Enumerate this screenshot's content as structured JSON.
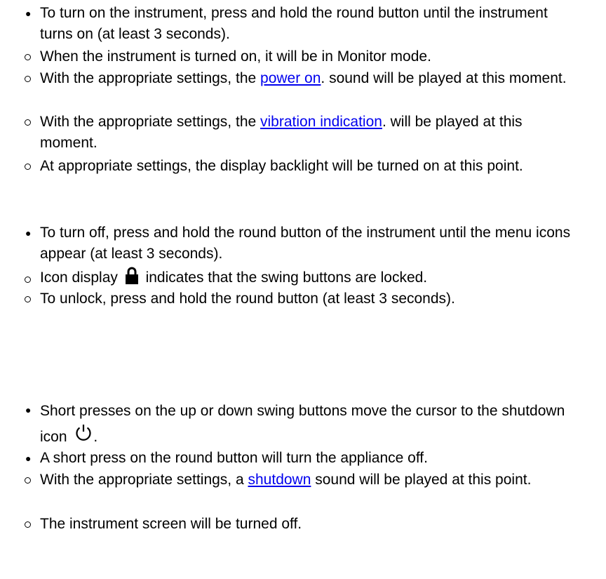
{
  "items": [
    {
      "marker": "disc",
      "text": "To turn on the instrument, press and hold the round button until the instrument turns on (at least 3 seconds)."
    },
    {
      "marker": "circle",
      "text": "When the instrument is turned on, it will be in Monitor mode."
    },
    {
      "marker": "circle",
      "pre": "With the appropriate settings, the ",
      "link": "power on",
      "post": ". sound will be played at this moment."
    },
    {
      "marker": "circle",
      "pre": "With the appropriate settings, the ",
      "link": "vibration indication",
      "post": ". will be played at this moment."
    },
    {
      "marker": "circle",
      "text": "At appropriate settings, the display backlight will be turned on at this point."
    },
    {
      "marker": "disc",
      "text": "To turn off, press and hold the round button of the instrument until the menu icons appear (at least 3 seconds)."
    },
    {
      "marker": "circle",
      "pre": "Icon display ",
      "icon": "lock-icon",
      "post": " indicates that the swing buttons are locked."
    },
    {
      "marker": "circle",
      "text": "To unlock, press and hold the round button (at least 3 seconds)."
    },
    {
      "marker": "disc",
      "pre": "Short presses on the up or down swing buttons move the cursor to the shutdown icon ",
      "icon": "power-icon",
      "post": "."
    },
    {
      "marker": "disc",
      "text": "A short press on the round button will turn the appliance off."
    },
    {
      "marker": "circle",
      "pre": "With the appropriate settings, a ",
      "link": "shutdown",
      "post": " sound will be played at this point."
    },
    {
      "marker": "circle",
      "text": "The instrument screen will be turned off."
    }
  ],
  "colors": {
    "link": "#0000ee",
    "text": "#000000",
    "background": "#ffffff"
  }
}
